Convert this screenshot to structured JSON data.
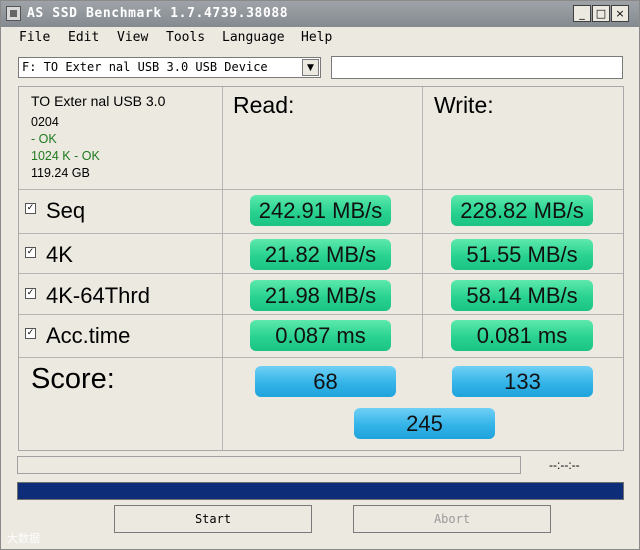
{
  "window": {
    "title": "AS SSD Benchmark 1.7.4739.38088",
    "minimize": "_",
    "maximize": "□",
    "close": "×"
  },
  "menu": [
    "File",
    "Edit",
    "View",
    "Tools",
    "Language",
    "Help"
  ],
  "drive": {
    "selected": "F: TO Exter nal USB 3.0 USB Device",
    "info_value": ""
  },
  "device_info": {
    "name": "TO Exter nal USB 3.0",
    "firmware": "0204",
    "driver_status": " - OK",
    "alignment": "1024 K - OK",
    "capacity": "119.24 GB"
  },
  "columns": {
    "read": "Read:",
    "write": "Write:"
  },
  "rows": [
    {
      "label": "Seq",
      "checked": true,
      "read": "242.91 MB/s",
      "write": "228.82 MB/s"
    },
    {
      "label": "4K",
      "checked": true,
      "read": "21.82 MB/s",
      "write": "51.55 MB/s"
    },
    {
      "label": "4K-64Thrd",
      "checked": true,
      "read": "21.98 MB/s",
      "write": "58.14 MB/s"
    },
    {
      "label": "Acc.time",
      "checked": true,
      "read": "0.087 ms",
      "write": "0.081 ms"
    }
  ],
  "score": {
    "label": "Score:",
    "read": "68",
    "write": "133",
    "total": "245"
  },
  "status": {
    "elapsed": "--:--:--",
    "progress_fraction": 1.0
  },
  "buttons": {
    "start": "Start",
    "abort": "Abort"
  },
  "watermark": "大数据"
}
